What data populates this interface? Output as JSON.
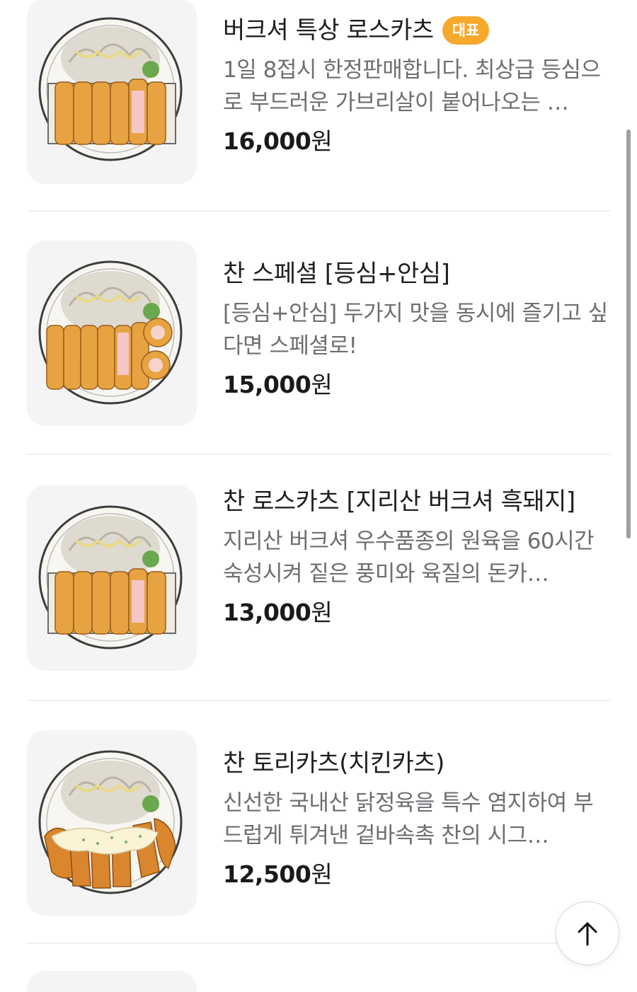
{
  "menu_items": [
    {
      "name": "버크셔 특상 로스카츠",
      "badge": "대표",
      "description": "1일 8접시 한정판매합니다. 최상급 등심으로 부드러운 가브리살이 붙어나오는 …",
      "price_number": "16,000",
      "price_unit": "원",
      "image": "pork-cutlet-plate-icon"
    },
    {
      "name": "찬 스페셜 [등심+안심]",
      "badge": "",
      "description": "[등심+안심] 두가지 맛을 동시에 즐기고 싶다면 스페셜로!",
      "price_number": "15,000",
      "price_unit": "원",
      "image": "special-cutlet-plate-icon"
    },
    {
      "name": "찬 로스카츠 [지리산 버크셔 흑돼지]",
      "badge": "",
      "description": "지리산 버크셔 우수품종의 원육을 60시간 숙성시켜 짙은 풍미와 육질의 돈카…",
      "price_number": "13,000",
      "price_unit": "원",
      "image": "pork-cutlet-plate-icon"
    },
    {
      "name": "찬 토리카츠(치킨카츠)",
      "badge": "",
      "description": "신선한 국내산 닭정육을 특수 염지하여 부드럽게 튀겨낸 겉바속촉 찬의 시그…",
      "price_number": "12,500",
      "price_unit": "원",
      "image": "chicken-cutlet-plate-icon"
    }
  ],
  "colors": {
    "badge": "#f6a92b",
    "cutlet": "#e9a43c",
    "plate_rim": "#4a4a4a",
    "cabbage": "#d9d4c4"
  },
  "scroll_top_icon": "arrow-up-icon"
}
